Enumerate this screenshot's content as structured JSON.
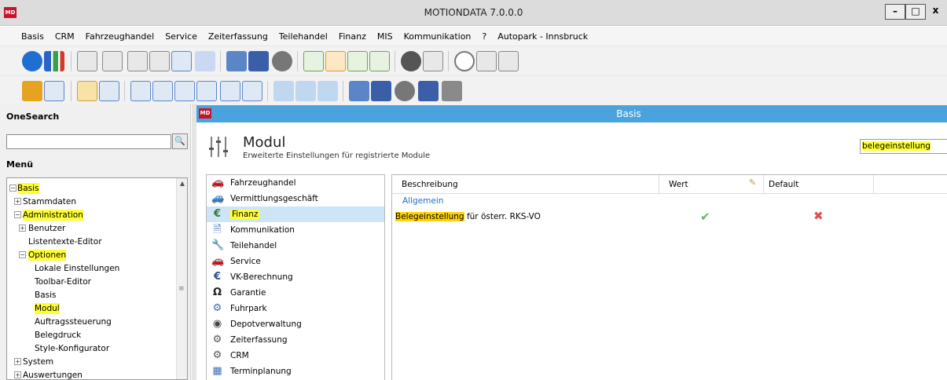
{
  "window": {
    "app_logo": "MD",
    "title": "MOTIONDATA 7.0.0.0",
    "min": "–",
    "max": "□",
    "close": "x"
  },
  "menu": [
    "Basis",
    "CRM",
    "Fahrzeughandel",
    "Service",
    "Zeiterfassung",
    "Teilehandel",
    "Finanz",
    "MIS",
    "Kommunikation",
    "?",
    "Autopark - Innsbruck"
  ],
  "left": {
    "onesearch_label": "OneSearch",
    "search_btn": "🔍",
    "menu_label": "Menü",
    "tree": [
      {
        "label": "Basis",
        "expand": "−",
        "highlight": true
      },
      {
        "label": "Stammdaten",
        "expand": "+",
        "highlight": false
      },
      {
        "label": "Administration",
        "expand": "−",
        "highlight": true
      },
      {
        "label": "Benutzer",
        "expand": "+",
        "highlight": false
      },
      {
        "label": "Listentexte-Editor",
        "expand": "",
        "highlight": false
      },
      {
        "label": "Optionen",
        "expand": "−",
        "highlight": true
      },
      {
        "label": "Lokale Einstellungen",
        "expand": "",
        "highlight": false
      },
      {
        "label": "Toolbar-Editor",
        "expand": "",
        "highlight": false
      },
      {
        "label": "Basis",
        "expand": "",
        "highlight": false
      },
      {
        "label": "Modul",
        "expand": "",
        "highlight": true
      },
      {
        "label": "Auftragssteuerung",
        "expand": "",
        "highlight": false
      },
      {
        "label": "Belegdruck",
        "expand": "",
        "highlight": false
      },
      {
        "label": "Style-Konfigurator",
        "expand": "",
        "highlight": false
      },
      {
        "label": "System",
        "expand": "+",
        "highlight": false
      },
      {
        "label": "Auswertungen",
        "expand": "+",
        "highlight": false
      }
    ]
  },
  "child": {
    "logo": "MD",
    "title": "Basis",
    "module_title": "Modul",
    "module_subtitle": "Erweiterte Einstellungen für registrierte Module",
    "search_value": "belegeinstellung",
    "modules": [
      {
        "label": "Fahrzeughandel",
        "icon": "car-icon",
        "glyph": "🚗",
        "selected": false
      },
      {
        "label": "Vermittlungsgeschäft",
        "icon": "car-icon",
        "glyph": "🚙",
        "selected": false
      },
      {
        "label": "Finanz",
        "icon": "euro-icon",
        "glyph": "€",
        "selected": true
      },
      {
        "label": "Kommunikation",
        "icon": "document-icon",
        "glyph": "🗎",
        "selected": false
      },
      {
        "label": "Teilehandel",
        "icon": "wrench-icon",
        "glyph": "🔧",
        "selected": false
      },
      {
        "label": "Service",
        "icon": "car-icon",
        "glyph": "🚗",
        "selected": false
      },
      {
        "label": "VK-Berechnung",
        "icon": "euro-icon",
        "glyph": "€",
        "selected": false
      },
      {
        "label": "Garantie",
        "icon": "omega-icon",
        "glyph": "Ω",
        "selected": false
      },
      {
        "label": "Fuhrpark",
        "icon": "gear-box-icon",
        "glyph": "⚙",
        "selected": false
      },
      {
        "label": "Depotverwaltung",
        "icon": "tire-icon",
        "glyph": "◉",
        "selected": false
      },
      {
        "label": "Zeiterfassung",
        "icon": "gear-icon",
        "glyph": "⚙",
        "selected": false
      },
      {
        "label": "CRM",
        "icon": "gear-icon",
        "glyph": "⚙",
        "selected": false
      },
      {
        "label": "Terminplanung",
        "icon": "calendar-icon",
        "glyph": "▦",
        "selected": false
      }
    ],
    "grid": {
      "columns": [
        "Beschreibung",
        "Wert",
        "Default"
      ],
      "group": "Allgemein",
      "row": {
        "highlight": "Belegeinstellung",
        "rest": " für österr. RKS-VO",
        "value": "✔",
        "default": "✖"
      }
    }
  },
  "colors": {
    "highlight": "#ffff33",
    "accent": "#4aa3dd",
    "check": "#5cb85c",
    "cross": "#e05050"
  }
}
